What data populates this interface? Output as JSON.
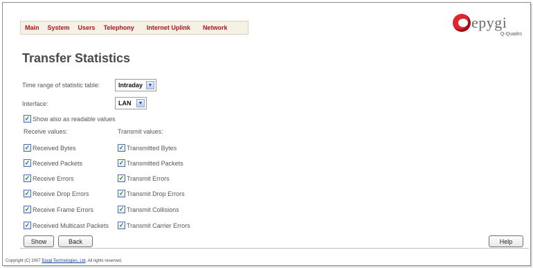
{
  "nav": {
    "items": [
      {
        "label": "Main"
      },
      {
        "label": "System"
      },
      {
        "label": "Users"
      },
      {
        "label": "Telephony"
      },
      {
        "label": "Internet Uplink"
      },
      {
        "label": "Network"
      }
    ]
  },
  "logo": {
    "text": "epygi",
    "sub": "Q-Quadro"
  },
  "page": {
    "title": "Transfer Statistics"
  },
  "form": {
    "time_range": {
      "label": "Time range of statistic table:",
      "value": "Intraday"
    },
    "interface": {
      "label": "Interface:",
      "value": "LAN"
    },
    "readable": {
      "label": "Show also as readable values",
      "checked": true
    },
    "receive_header": "Receive values:",
    "transmit_header": "Transmit values:",
    "receive": [
      {
        "label": "Received Bytes",
        "checked": true
      },
      {
        "label": "Received Packets",
        "checked": true
      },
      {
        "label": "Receive Errors",
        "checked": true
      },
      {
        "label": "Receive Drop Errors",
        "checked": true
      },
      {
        "label": "Receive Frame Errors",
        "checked": true
      },
      {
        "label": "Received Multicast Packets",
        "checked": true
      }
    ],
    "transmit": [
      {
        "label": "Transmitted Bytes",
        "checked": true
      },
      {
        "label": "Transmitted Packets",
        "checked": true
      },
      {
        "label": "Transmit Errors",
        "checked": true
      },
      {
        "label": "Transmit Drop Errors",
        "checked": true
      },
      {
        "label": "Transmit Collisions",
        "checked": true
      },
      {
        "label": "Transmit Carrier Errors",
        "checked": true
      }
    ]
  },
  "buttons": {
    "show": "Show",
    "back": "Back",
    "help": "Help"
  },
  "footer": {
    "prefix": "Copyright (C) 2007 ",
    "link": "Epygi Technologies, Ltd",
    "suffix": ". All rights reserved."
  },
  "check_glyph": "✓",
  "colors": {
    "nav_text": "#b3121f",
    "brand_red": "#e0252c"
  }
}
